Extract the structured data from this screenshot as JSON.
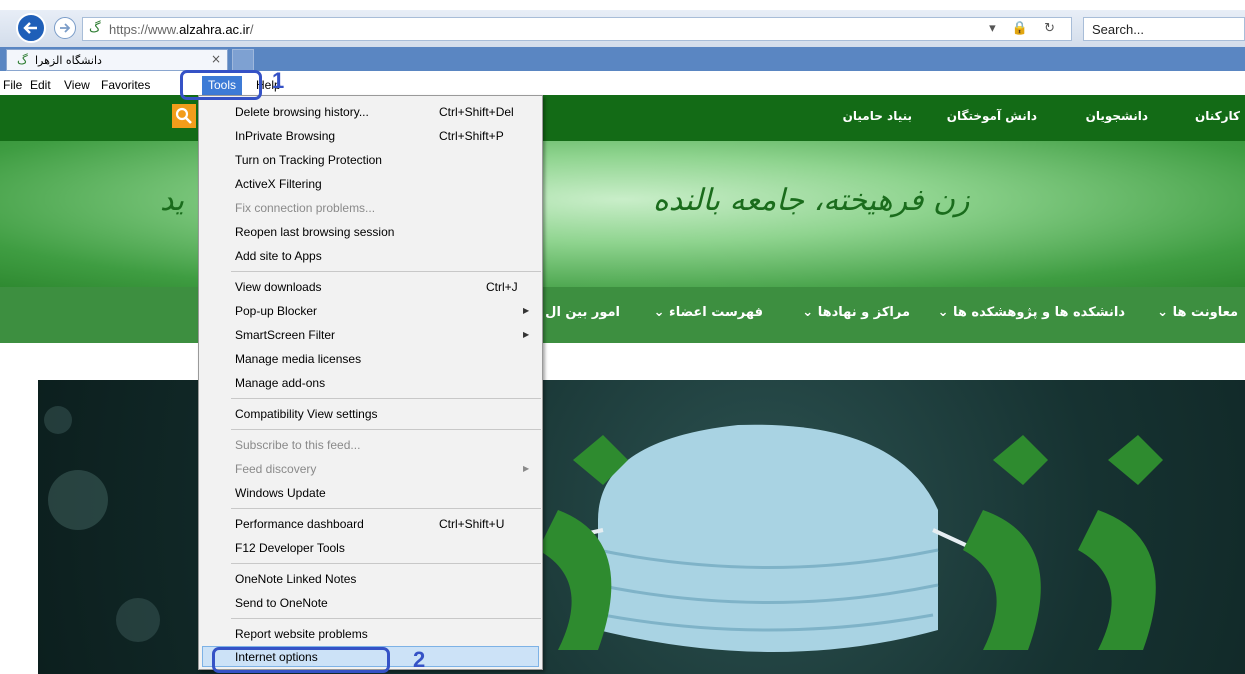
{
  "browser": {
    "url_prefix": "https://www.",
    "url_domain": "alzahra.ac.ir",
    "url_suffix": "/",
    "search_placeholder": "Search...",
    "tab_title": "دانشگاه الزهرا",
    "tab_close": "×",
    "url_icons": "▾ 🔒 ↻"
  },
  "menubar": [
    "File",
    "Edit",
    "View",
    "Favorites",
    "Tools",
    "Help"
  ],
  "site": {
    "top_links": [
      "کارکنان",
      "دانشجویان",
      "دانش آموختگان",
      "بنیاد حامیان"
    ],
    "slogan": "زن فرهیخته، جامعه بالنده",
    "slogan_left": "ید",
    "main_links": [
      "معاونت ها ⌄",
      "دانشکده ها و پژوهشکده ها ⌄",
      "مراکز و نهادها ⌄",
      "فهرست اعضاء ⌄",
      "امور بین ال"
    ]
  },
  "tools_menu": {
    "items": [
      {
        "label": "Delete browsing history...",
        "shortcut": "Ctrl+Shift+Del"
      },
      {
        "label": "InPrivate Browsing",
        "shortcut": "Ctrl+Shift+P"
      },
      {
        "label": "Turn on Tracking Protection",
        "shortcut": ""
      },
      {
        "label": "ActiveX Filtering",
        "shortcut": ""
      },
      {
        "label": "Fix connection problems...",
        "shortcut": ""
      },
      {
        "label": "Reopen last browsing session",
        "shortcut": ""
      },
      {
        "label": "Add site to Apps",
        "shortcut": ""
      },
      {
        "label": "View downloads",
        "shortcut": "Ctrl+J"
      },
      {
        "label": "Pop-up Blocker",
        "shortcut": ""
      },
      {
        "label": "SmartScreen Filter",
        "shortcut": ""
      },
      {
        "label": "Manage media licenses",
        "shortcut": ""
      },
      {
        "label": "Manage add-ons",
        "shortcut": ""
      },
      {
        "label": "Compatibility View settings",
        "shortcut": ""
      },
      {
        "label": "Subscribe to this feed...",
        "shortcut": ""
      },
      {
        "label": "Feed discovery",
        "shortcut": ""
      },
      {
        "label": "Windows Update",
        "shortcut": ""
      },
      {
        "label": "Performance dashboard",
        "shortcut": "Ctrl+Shift+U"
      },
      {
        "label": "F12 Developer Tools",
        "shortcut": ""
      },
      {
        "label": "OneNote Linked Notes",
        "shortcut": ""
      },
      {
        "label": "Send to OneNote",
        "shortcut": ""
      },
      {
        "label": "Report website problems",
        "shortcut": ""
      },
      {
        "label": "Internet options",
        "shortcut": ""
      }
    ]
  },
  "annotations": {
    "step1": "1",
    "step2": "2",
    "color": "#3552c6"
  },
  "colors": {
    "site_green_dark": "#136b16",
    "site_green_nav": "#3d8f40",
    "menu_highlight": "#3d7bd6",
    "search_orange": "#f29d1b"
  }
}
